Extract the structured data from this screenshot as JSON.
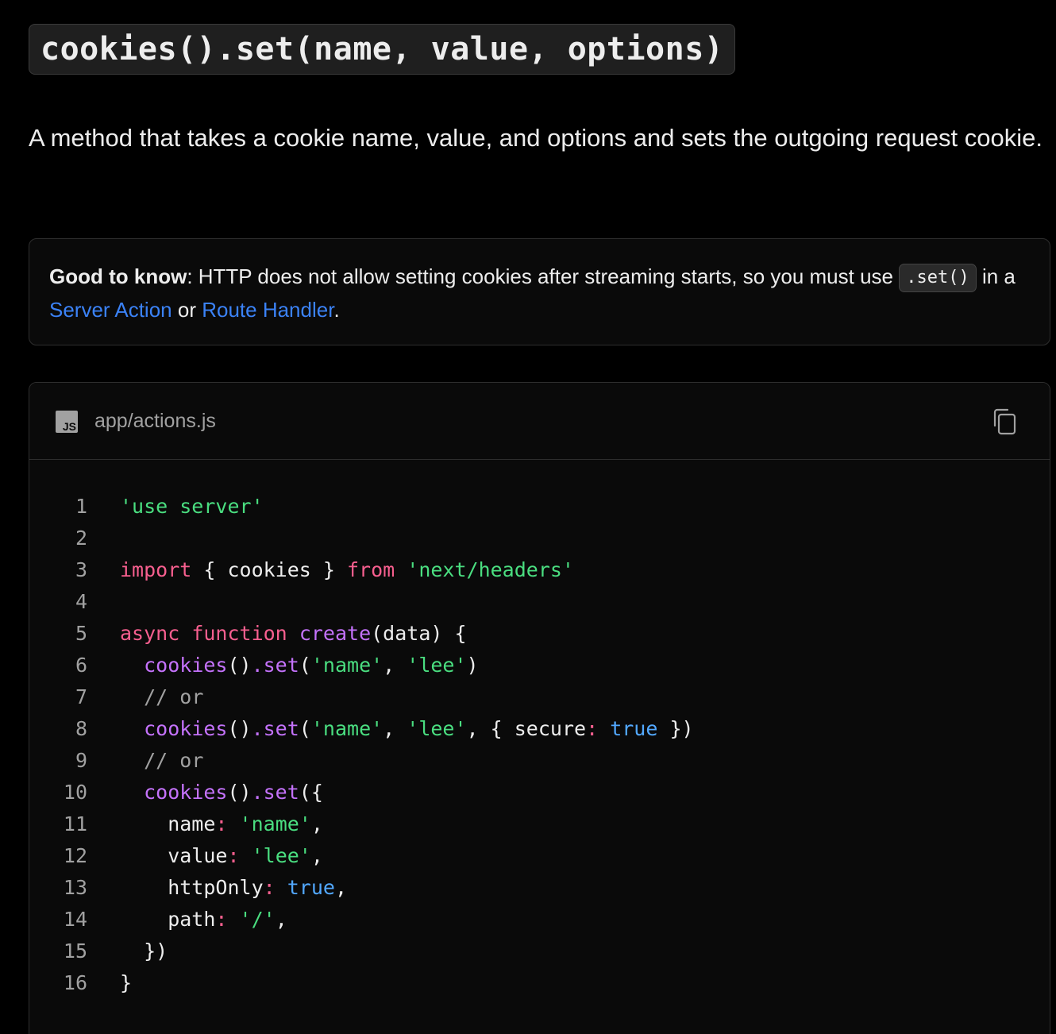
{
  "heading": {
    "code": "cookies().set(name, value, options)"
  },
  "description": "A method that takes a cookie name, value, and options and sets the outgoing request cookie.",
  "callout": {
    "label": "Good to know",
    "text_before": ": HTTP does not allow setting cookies after streaming starts, so you must use ",
    "inline_code": ".set()",
    "text_middle": " in a ",
    "link1": "Server Action",
    "text_or": " or ",
    "link2": "Route Handler",
    "text_end": "."
  },
  "code_block": {
    "language_badge": "JS",
    "filename": "app/actions.js",
    "copy_icon": "copy-icon",
    "lines": [
      {
        "n": "1",
        "tokens": [
          {
            "t": "str",
            "v": "'use server'"
          }
        ]
      },
      {
        "n": "2",
        "tokens": []
      },
      {
        "n": "3",
        "tokens": [
          {
            "t": "kw",
            "v": "import"
          },
          {
            "t": "pl",
            "v": " { cookies } "
          },
          {
            "t": "kw",
            "v": "from"
          },
          {
            "t": "pl",
            "v": " "
          },
          {
            "t": "str",
            "v": "'next/headers'"
          }
        ]
      },
      {
        "n": "4",
        "tokens": []
      },
      {
        "n": "5",
        "tokens": [
          {
            "t": "kw",
            "v": "async"
          },
          {
            "t": "pl",
            "v": " "
          },
          {
            "t": "kw",
            "v": "function"
          },
          {
            "t": "pl",
            "v": " "
          },
          {
            "t": "fn",
            "v": "create"
          },
          {
            "t": "pl",
            "v": "(data) {"
          }
        ]
      },
      {
        "n": "6",
        "tokens": [
          {
            "t": "pl",
            "v": "  "
          },
          {
            "t": "fn",
            "v": "cookies"
          },
          {
            "t": "pl",
            "v": "()"
          },
          {
            "t": "fn",
            "v": ".set"
          },
          {
            "t": "pl",
            "v": "("
          },
          {
            "t": "str",
            "v": "'name'"
          },
          {
            "t": "pl",
            "v": ", "
          },
          {
            "t": "str",
            "v": "'lee'"
          },
          {
            "t": "pl",
            "v": ")"
          }
        ]
      },
      {
        "n": "7",
        "tokens": [
          {
            "t": "pl",
            "v": "  "
          },
          {
            "t": "cm",
            "v": "// or"
          }
        ]
      },
      {
        "n": "8",
        "tokens": [
          {
            "t": "pl",
            "v": "  "
          },
          {
            "t": "fn",
            "v": "cookies"
          },
          {
            "t": "pl",
            "v": "()"
          },
          {
            "t": "fn",
            "v": ".set"
          },
          {
            "t": "pl",
            "v": "("
          },
          {
            "t": "str",
            "v": "'name'"
          },
          {
            "t": "pl",
            "v": ", "
          },
          {
            "t": "str",
            "v": "'lee'"
          },
          {
            "t": "pl",
            "v": ", { secure"
          },
          {
            "t": "kw",
            "v": ":"
          },
          {
            "t": "pl",
            "v": " "
          },
          {
            "t": "bool",
            "v": "true"
          },
          {
            "t": "pl",
            "v": " })"
          }
        ]
      },
      {
        "n": "9",
        "tokens": [
          {
            "t": "pl",
            "v": "  "
          },
          {
            "t": "cm",
            "v": "// or"
          }
        ]
      },
      {
        "n": "10",
        "tokens": [
          {
            "t": "pl",
            "v": "  "
          },
          {
            "t": "fn",
            "v": "cookies"
          },
          {
            "t": "pl",
            "v": "()"
          },
          {
            "t": "fn",
            "v": ".set"
          },
          {
            "t": "pl",
            "v": "({"
          }
        ]
      },
      {
        "n": "11",
        "tokens": [
          {
            "t": "pl",
            "v": "    name"
          },
          {
            "t": "kw",
            "v": ":"
          },
          {
            "t": "pl",
            "v": " "
          },
          {
            "t": "str",
            "v": "'name'"
          },
          {
            "t": "pl",
            "v": ","
          }
        ]
      },
      {
        "n": "12",
        "tokens": [
          {
            "t": "pl",
            "v": "    value"
          },
          {
            "t": "kw",
            "v": ":"
          },
          {
            "t": "pl",
            "v": " "
          },
          {
            "t": "str",
            "v": "'lee'"
          },
          {
            "t": "pl",
            "v": ","
          }
        ]
      },
      {
        "n": "13",
        "tokens": [
          {
            "t": "pl",
            "v": "    httpOnly"
          },
          {
            "t": "kw",
            "v": ":"
          },
          {
            "t": "pl",
            "v": " "
          },
          {
            "t": "bool",
            "v": "true"
          },
          {
            "t": "pl",
            "v": ","
          }
        ]
      },
      {
        "n": "14",
        "tokens": [
          {
            "t": "pl",
            "v": "    path"
          },
          {
            "t": "kw",
            "v": ":"
          },
          {
            "t": "pl",
            "v": " "
          },
          {
            "t": "str",
            "v": "'/'"
          },
          {
            "t": "pl",
            "v": ","
          }
        ]
      },
      {
        "n": "15",
        "tokens": [
          {
            "t": "pl",
            "v": "  })"
          }
        ]
      },
      {
        "n": "16",
        "tokens": [
          {
            "t": "pl",
            "v": "}"
          }
        ]
      }
    ]
  },
  "colors": {
    "background": "#000000",
    "text": "#ededed",
    "link": "#3b82f6",
    "string": "#4ade80",
    "keyword": "#f75f8f",
    "function": "#c472fb",
    "comment": "#a1a1a1",
    "boolean": "#52a8ff"
  }
}
